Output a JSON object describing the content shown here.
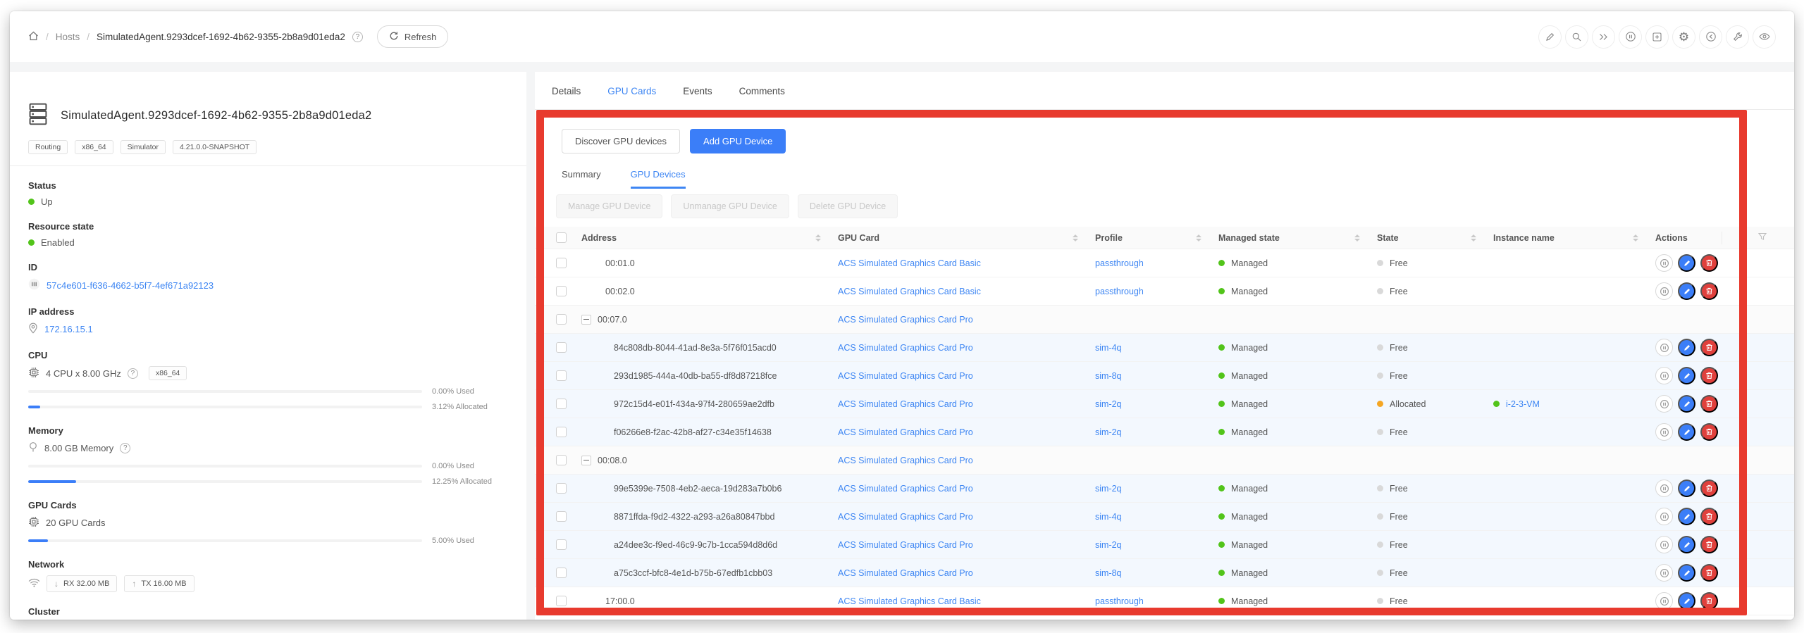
{
  "breadcrumb": {
    "section": "Hosts",
    "separator": "/",
    "current": "SimulatedAgent.9293dcef-1692-4b62-9355-2b8a9d01eda2",
    "refresh_label": "Refresh"
  },
  "toolbar_icons": [
    "edit-icon",
    "search-icon",
    "fast-forward-icon",
    "pause-circle-icon",
    "add-window-icon",
    "settings-gear-icon",
    "navigate-circle-icon",
    "wrench-icon",
    "eye-icon"
  ],
  "host_panel": {
    "title": "SimulatedAgent.9293dcef-1692-4b62-9355-2b8a9d01eda2",
    "tags": [
      "Routing",
      "x86_64",
      "Simulator",
      "4.21.0.0-SNAPSHOT"
    ],
    "status": {
      "label": "Status",
      "value": "Up"
    },
    "resource_state": {
      "label": "Resource state",
      "value": "Enabled"
    },
    "id": {
      "label": "ID",
      "value": "57c4e601-f636-4662-b5f7-4ef671a92123"
    },
    "ip": {
      "label": "IP address",
      "value": "172.16.15.1"
    },
    "cpu": {
      "label": "CPU",
      "value": "4 CPU x 8.00 GHz",
      "arch_tag": "x86_64",
      "meters": [
        {
          "pct": 0,
          "label": "0.00% Used"
        },
        {
          "pct": 3.12,
          "label": "3.12% Allocated"
        }
      ]
    },
    "memory": {
      "label": "Memory",
      "value": "8.00 GB Memory",
      "meters": [
        {
          "pct": 0,
          "label": "0.00% Used"
        },
        {
          "pct": 12.25,
          "label": "12.25% Allocated"
        }
      ]
    },
    "gpu_cards": {
      "label": "GPU Cards",
      "value": "20 GPU Cards",
      "meters": [
        {
          "pct": 5,
          "label": "5.00% Used"
        }
      ]
    },
    "network": {
      "label": "Network",
      "rx": "RX 32.00 MB",
      "tx": "TX 16.00 MB"
    },
    "cluster": {
      "label": "Cluster"
    }
  },
  "tabs": {
    "items": [
      "Details",
      "GPU Cards",
      "Events",
      "Comments"
    ],
    "active": "GPU Cards"
  },
  "gpu_panel": {
    "discover_button": "Discover GPU devices",
    "add_button": "Add GPU Device",
    "subtabs": {
      "items": [
        "Summary",
        "GPU Devices"
      ],
      "active": "GPU Devices"
    },
    "bulk_buttons": [
      "Manage GPU Device",
      "Unmanage GPU Device",
      "Delete GPU Device"
    ],
    "table": {
      "columns": [
        "Address",
        "GPU Card",
        "Profile",
        "Managed state",
        "State",
        "Instance name",
        "Actions"
      ],
      "rows": [
        {
          "kind": "device",
          "address": "00:01.0",
          "card": "ACS Simulated Graphics Card Basic",
          "profile": "passthrough",
          "managed_state": "Managed",
          "state": "Free",
          "instance": null
        },
        {
          "kind": "device",
          "address": "00:02.0",
          "card": "ACS Simulated Graphics Card Basic",
          "profile": "passthrough",
          "managed_state": "Managed",
          "state": "Free",
          "instance": null
        },
        {
          "kind": "group",
          "address": "00:07.0",
          "card": "ACS Simulated Graphics Card Pro"
        },
        {
          "kind": "device",
          "child": true,
          "address": "84c808db-8044-41ad-8e3a-5f76f015acd0",
          "card": "ACS Simulated Graphics Card Pro",
          "profile": "sim-4q",
          "managed_state": "Managed",
          "state": "Free",
          "instance": null
        },
        {
          "kind": "device",
          "child": true,
          "address": "293d1985-444a-40db-ba55-df8d87218fce",
          "card": "ACS Simulated Graphics Card Pro",
          "profile": "sim-8q",
          "managed_state": "Managed",
          "state": "Free",
          "instance": null
        },
        {
          "kind": "device",
          "child": true,
          "address": "972c15d4-e01f-434a-97f4-280659ae2dfb",
          "card": "ACS Simulated Graphics Card Pro",
          "profile": "sim-2q",
          "managed_state": "Managed",
          "state": "Allocated",
          "instance": "i-2-3-VM"
        },
        {
          "kind": "device",
          "child": true,
          "address": "f06266e8-f2ac-42b8-af27-c34e35f14638",
          "card": "ACS Simulated Graphics Card Pro",
          "profile": "sim-2q",
          "managed_state": "Managed",
          "state": "Free",
          "instance": null
        },
        {
          "kind": "group",
          "address": "00:08.0",
          "card": "ACS Simulated Graphics Card Pro"
        },
        {
          "kind": "device",
          "child": true,
          "address": "99e5399e-7508-4eb2-aeca-19d283a7b0b6",
          "card": "ACS Simulated Graphics Card Pro",
          "profile": "sim-2q",
          "managed_state": "Managed",
          "state": "Free",
          "instance": null
        },
        {
          "kind": "device",
          "child": true,
          "address": "8871ffda-f9d2-4322-a293-a26a80847bbd",
          "card": "ACS Simulated Graphics Card Pro",
          "profile": "sim-4q",
          "managed_state": "Managed",
          "state": "Free",
          "instance": null
        },
        {
          "kind": "device",
          "child": true,
          "address": "a24dee3c-f9ed-46c9-9c7b-1cca594d8d6d",
          "card": "ACS Simulated Graphics Card Pro",
          "profile": "sim-2q",
          "managed_state": "Managed",
          "state": "Free",
          "instance": null
        },
        {
          "kind": "device",
          "child": true,
          "address": "a75c3ccf-bfc8-4e1d-b75b-67edfb1cbb03",
          "card": "ACS Simulated Graphics Card Pro",
          "profile": "sim-8q",
          "managed_state": "Managed",
          "state": "Free",
          "instance": null
        },
        {
          "kind": "device",
          "address": "17:00.0",
          "card": "ACS Simulated Graphics Card Basic",
          "profile": "passthrough",
          "managed_state": "Managed",
          "state": "Free",
          "instance": null
        }
      ]
    }
  },
  "colors": {
    "accent_blue": "#3b7ef8",
    "link_blue": "#3e86f3",
    "managed_green": "#52c41a",
    "allocated_orange": "#f5a623",
    "free_gray": "#d9d9d9",
    "annotation_red": "#e83a2e",
    "delete_red": "#e0403c"
  }
}
